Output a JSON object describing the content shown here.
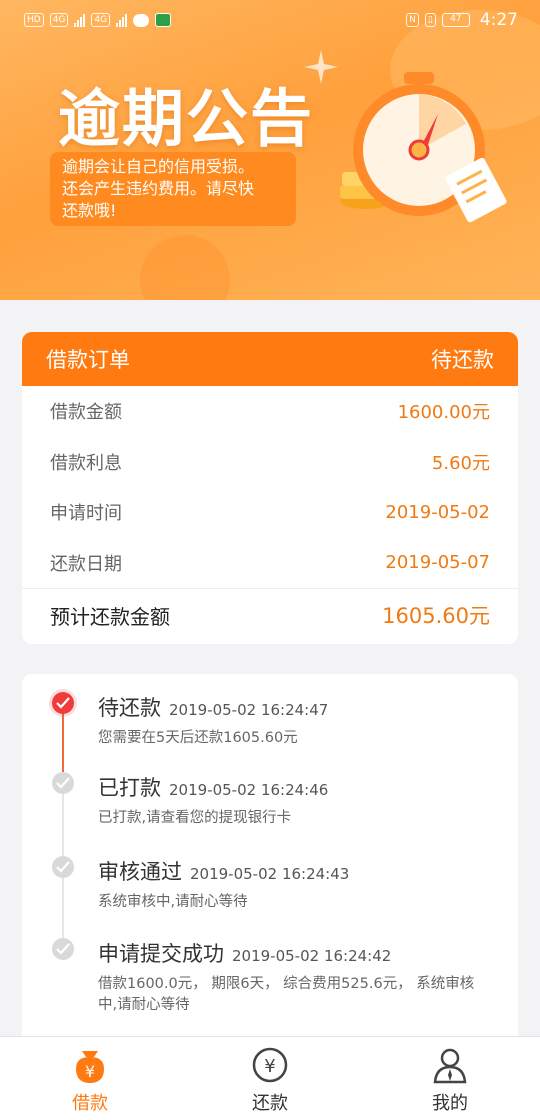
{
  "status_bar": {
    "left_chips": [
      "HD",
      "4G",
      "4G"
    ],
    "time": "4:27",
    "battery": "47"
  },
  "banner": {
    "title": "逾期公告",
    "note_lines": [
      "逾期会让自己的信用受损。",
      "还会产生违约费用。请尽快",
      "还款哦!"
    ]
  },
  "order": {
    "header_title": "借款订单",
    "header_status": "待还款",
    "rows": [
      {
        "label": "借款金额",
        "value": "1600.00元"
      },
      {
        "label": "借款利息",
        "value": "5.60元"
      },
      {
        "label": "申请时间",
        "value": "2019-05-02"
      },
      {
        "label": "还款日期",
        "value": "2019-05-07"
      }
    ],
    "total_label": "预计还款金额",
    "total_value": "1605.60元"
  },
  "timeline": [
    {
      "status": "待还款",
      "time": "2019-05-02 16:24:47",
      "desc": "您需要在5天后还款1605.60元",
      "state": "active"
    },
    {
      "status": "已打款",
      "time": "2019-05-02 16:24:46",
      "desc": "已打款,请查看您的提现银行卡",
      "state": "done"
    },
    {
      "status": "审核通过",
      "time": "2019-05-02 16:24:43",
      "desc": "系统审核中,请耐心等待",
      "state": "done"
    },
    {
      "status": "申请提交成功",
      "time": "2019-05-02 16:24:42",
      "desc": "借款1600.0元， 期限6天， 综合费用525.6元， 系统审核中,请耐心等待",
      "state": "done"
    }
  ],
  "bottom_nav": [
    {
      "label": "借款",
      "icon": "loan-bag-icon",
      "active": true
    },
    {
      "label": "还款",
      "icon": "yen-circle-icon",
      "active": false
    },
    {
      "label": "我的",
      "icon": "user-icon",
      "active": false
    }
  ],
  "colors": {
    "accent": "#ff7b12",
    "amount": "#f07a12",
    "active_dot": "#ef3b3b",
    "inactive_dot": "#d9d9d9"
  }
}
